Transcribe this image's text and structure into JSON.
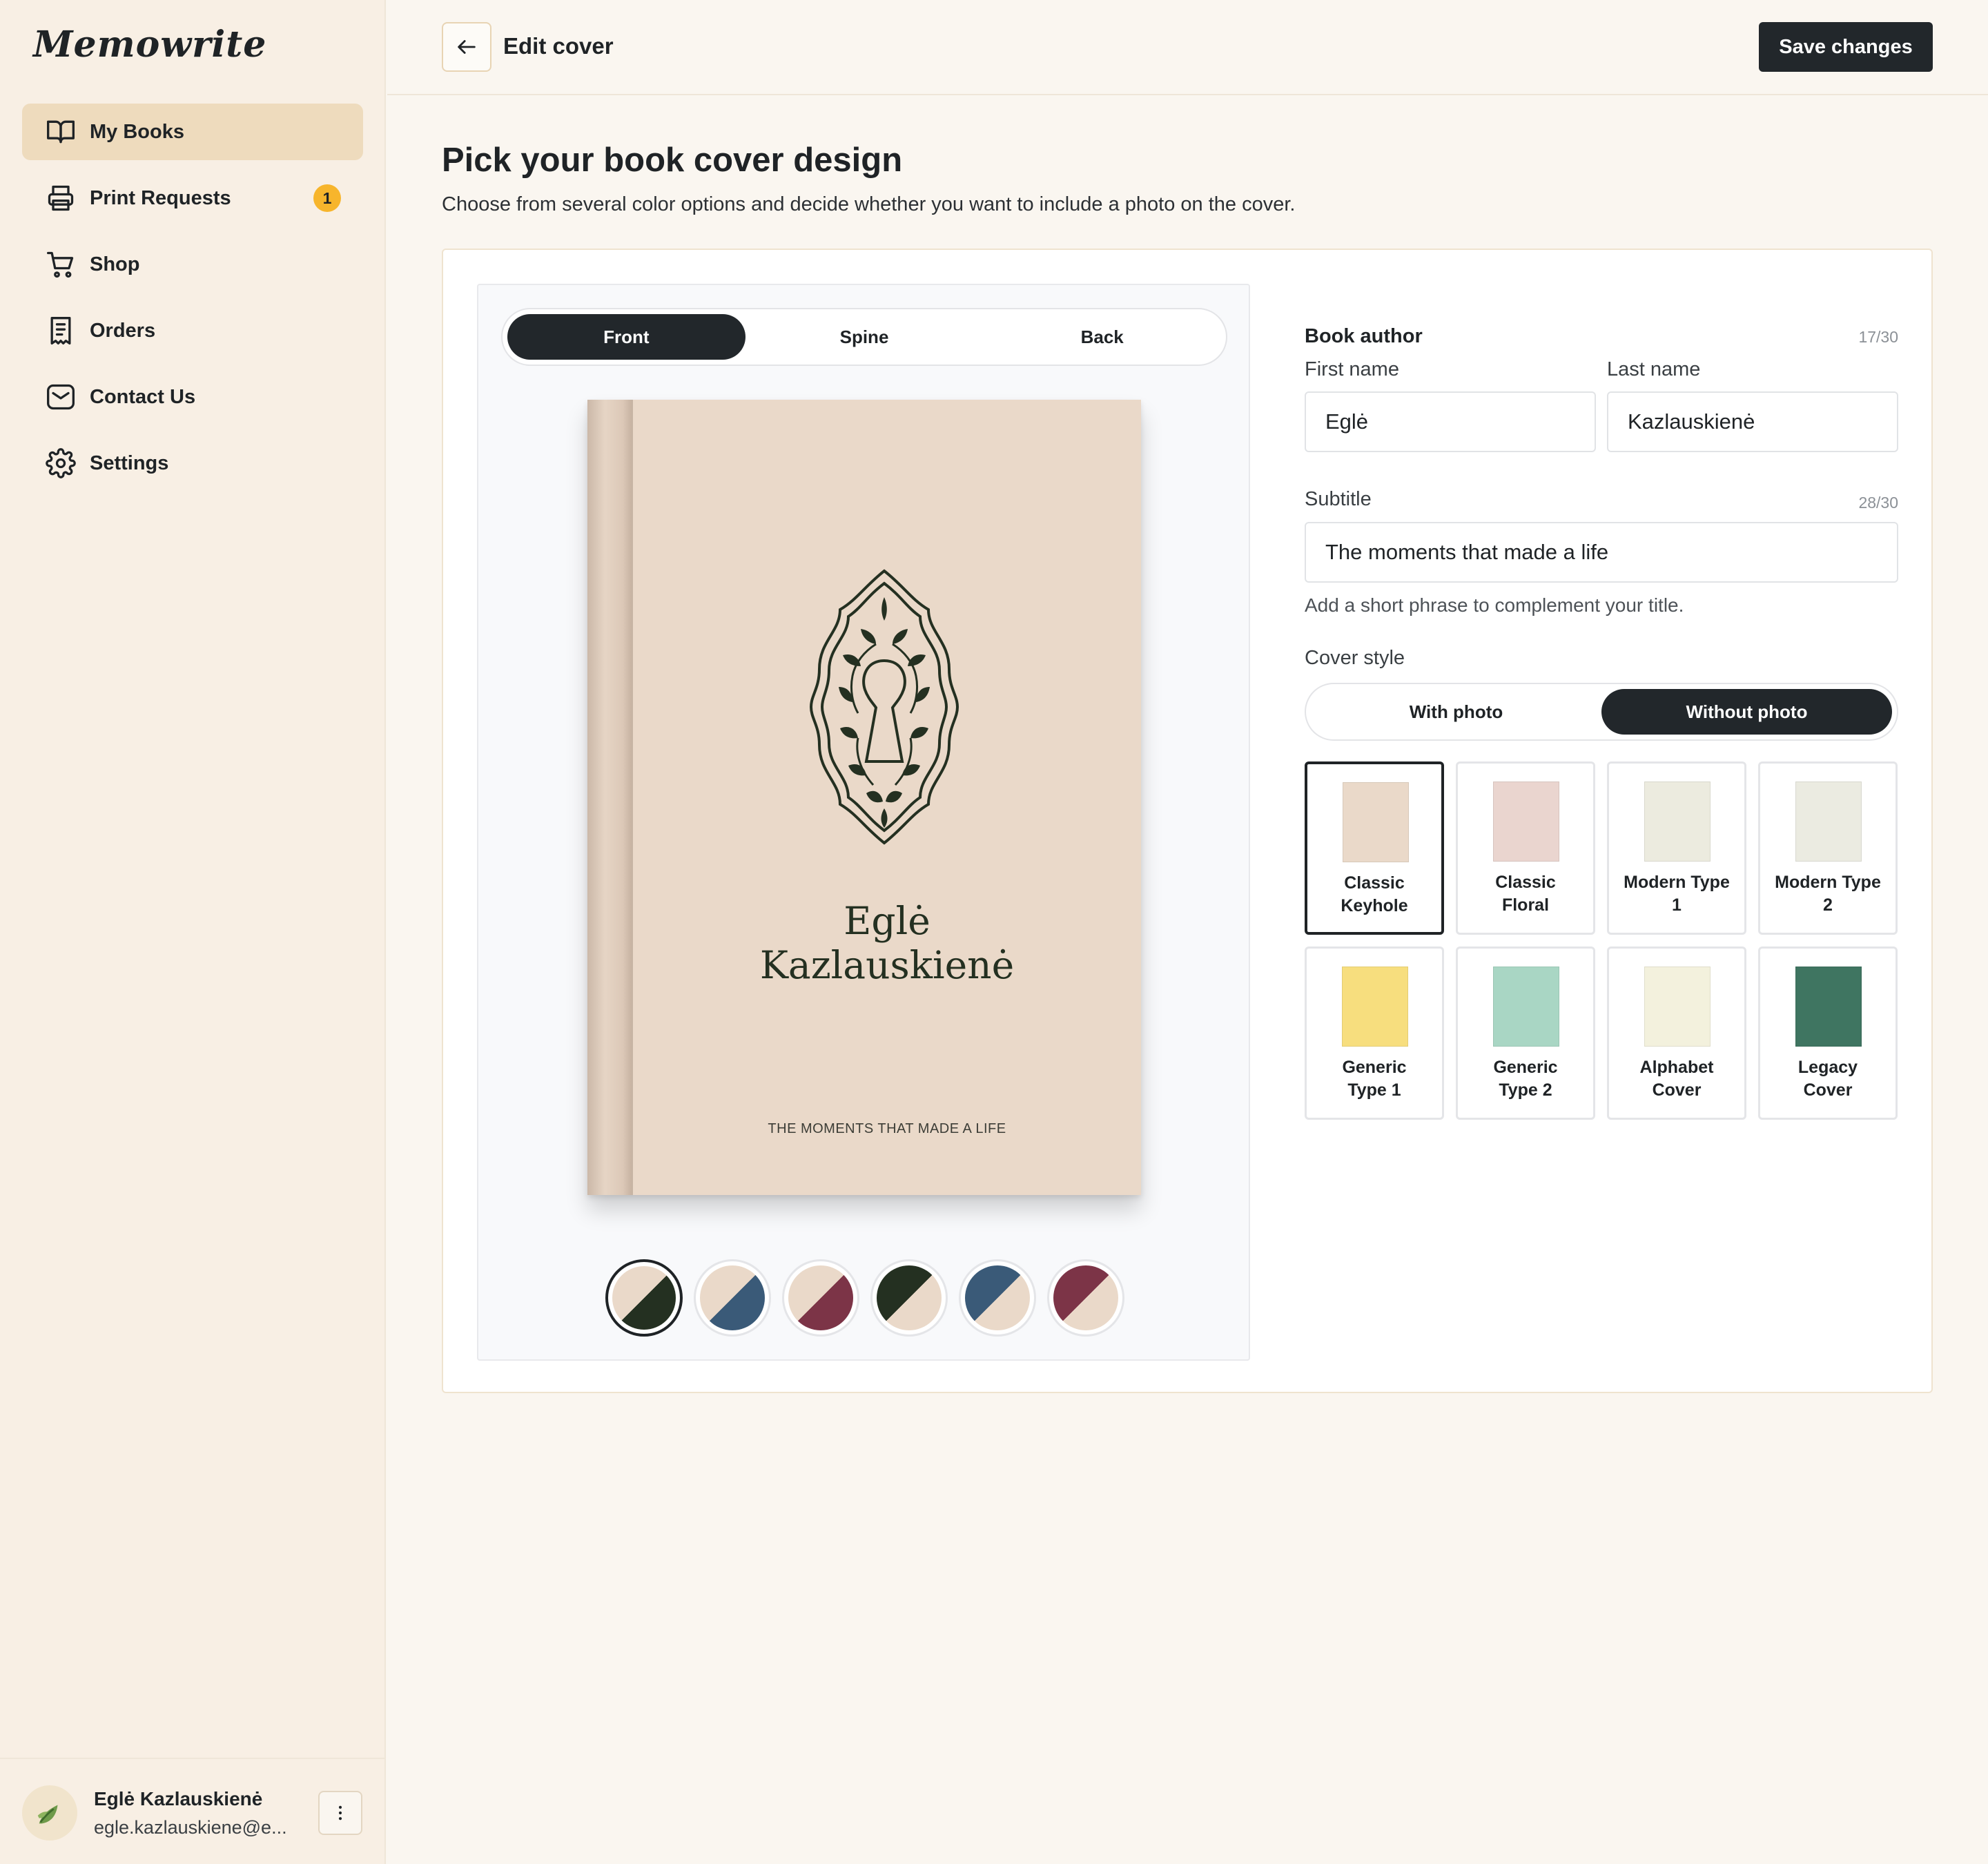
{
  "app": {
    "logo": "Memowrite"
  },
  "sidebar": {
    "items": [
      {
        "label": "My Books",
        "icon": "book-open-icon",
        "active": true
      },
      {
        "label": "Print Requests",
        "icon": "printer-icon",
        "badge": "1"
      },
      {
        "label": "Shop",
        "icon": "cart-icon"
      },
      {
        "label": "Orders",
        "icon": "receipt-icon"
      },
      {
        "label": "Contact Us",
        "icon": "mail-icon"
      },
      {
        "label": "Settings",
        "icon": "gear-icon"
      }
    ],
    "user": {
      "name": "Eglė Kazlauskienė",
      "email": "egle.kazlauskiene@e..."
    }
  },
  "header": {
    "title": "Edit cover",
    "save_label": "Save changes"
  },
  "main": {
    "title": "Pick your book cover design",
    "description": "Choose from several color options and decide whether you want to include a photo on the cover."
  },
  "preview": {
    "tabs": [
      {
        "label": "Front",
        "active": true
      },
      {
        "label": "Spine"
      },
      {
        "label": "Back"
      }
    ],
    "book": {
      "name_line1": "Eglė",
      "name_line2": "Kazlauskienė",
      "subtitle": "THE MOMENTS THAT MADE A LIFE",
      "background": "#ead9c9",
      "ink": "#243021"
    },
    "swatches": [
      {
        "a": "#ead9c9",
        "b": "#243021",
        "selected": true
      },
      {
        "a": "#ead9c9",
        "b": "#3a5a78"
      },
      {
        "a": "#ead9c9",
        "b": "#7c3447"
      },
      {
        "a": "#243021",
        "b": "#ead9c9"
      },
      {
        "a": "#3a5a78",
        "b": "#ead9c9"
      },
      {
        "a": "#7c3447",
        "b": "#ead9c9"
      }
    ]
  },
  "form": {
    "author": {
      "label": "Book author",
      "counter": "17/30",
      "first_label": "First name",
      "first_value": "Eglė",
      "last_label": "Last name",
      "last_value": "Kazlauskienė"
    },
    "subtitle": {
      "label": "Subtitle",
      "counter": "28/30",
      "value": "The moments that made a life",
      "help": "Add a short phrase to complement your title."
    },
    "cover_style": {
      "label": "Cover style",
      "options": [
        {
          "label": "With photo"
        },
        {
          "label": "Without photo",
          "active": true
        }
      ]
    },
    "designs": [
      {
        "label": "Classic Keyhole",
        "color": "#ead9c9",
        "selected": true
      },
      {
        "label": "Classic Floral",
        "color": "#ead5cf"
      },
      {
        "label": "Modern Type 1",
        "color": "#ecebdf"
      },
      {
        "label": "Modern Type 2",
        "color": "#ebebe1"
      },
      {
        "label": "Generic Type 1",
        "color": "#f7de7e"
      },
      {
        "label": "Generic Type 2",
        "color": "#a9d6c4"
      },
      {
        "label": "Alphabet Cover",
        "color": "#f3f1dd"
      },
      {
        "label": "Legacy Cover",
        "color": "#3f7561"
      }
    ]
  }
}
